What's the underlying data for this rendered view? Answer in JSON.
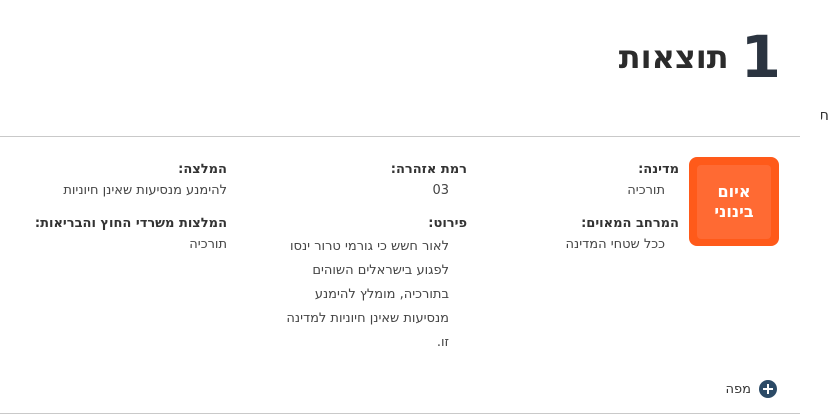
{
  "header": {
    "count": "1",
    "label": "תוצאות"
  },
  "side_fragment": "ת",
  "badge": {
    "line1": "איום",
    "line2": "בינוני",
    "color": "#ff5a1a"
  },
  "col_country": {
    "country_label": "מדינה:",
    "country_value": "תורכיה",
    "region_label": "המרחב המאוים:",
    "region_value": "ככל שטחי המדינה"
  },
  "col_warning": {
    "level_label": "רמת אזהרה:",
    "level_value": "03",
    "detail_label": "פירוט:",
    "detail_lines": [
      "לאור חשש כי גורמי טרור ינסו",
      "לפגוע בישראלים השוהים",
      "בתורכיה, מומלץ להימנע",
      "מנסיעות שאינן חיוניות למדינה",
      "זו."
    ]
  },
  "col_recommendation": {
    "rec_label": "המלצה:",
    "rec_value": "להימנע מנסיעות שאינן חיוניות",
    "ministries_label": "המלצות משרדי החוץ והבריאות:",
    "ministries_value": "תורכיה"
  },
  "map": {
    "label": "מפה",
    "icon": "plus-circle-icon",
    "icon_color": "#2b4a66"
  }
}
